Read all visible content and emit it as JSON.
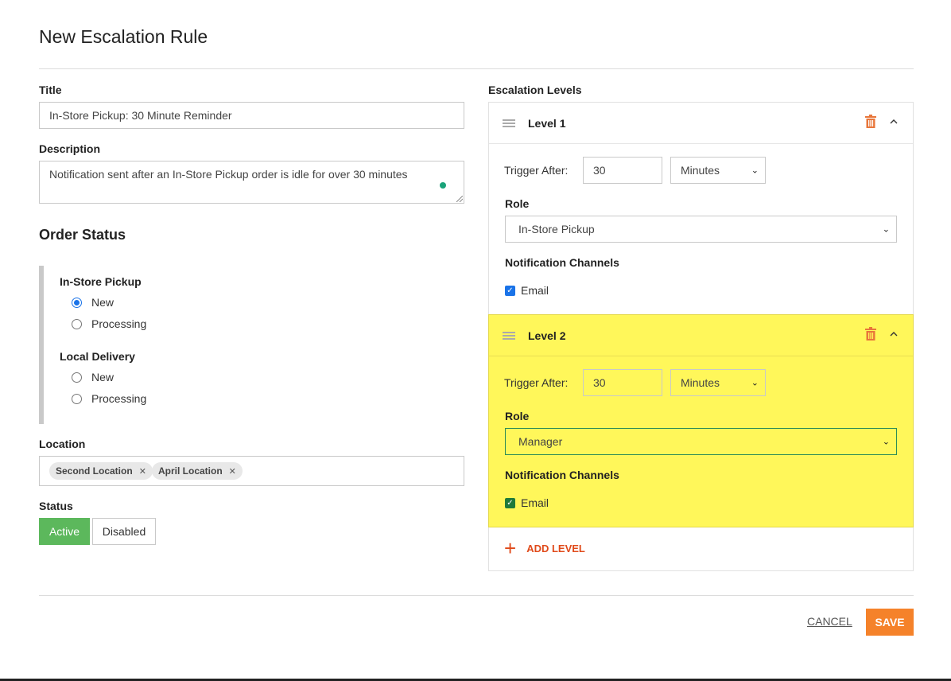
{
  "dialog": {
    "title": "New Escalation Rule"
  },
  "form": {
    "title_label": "Title",
    "title_value": "In-Store Pickup: 30 Minute Reminder",
    "description_label": "Description",
    "description_value": "Notification sent after an In-Store Pickup order is idle for over 30 minutes",
    "order_status_heading": "Order Status",
    "order_status_groups": [
      {
        "label": "In-Store Pickup",
        "options": [
          {
            "label": "New",
            "checked": true
          },
          {
            "label": "Processing",
            "checked": false
          }
        ]
      },
      {
        "label": "Local Delivery",
        "options": [
          {
            "label": "New",
            "checked": false
          },
          {
            "label": "Processing",
            "checked": false
          }
        ]
      }
    ],
    "location_label": "Location",
    "locations": [
      "Second Location",
      "April Location"
    ],
    "status_label": "Status",
    "status_options": [
      "Active",
      "Disabled"
    ],
    "status_selected": "Active"
  },
  "escalation": {
    "heading": "Escalation Levels",
    "levels": [
      {
        "title": "Level 1",
        "trigger_label": "Trigger After:",
        "trigger_value": "30",
        "trigger_unit": "Minutes",
        "role_label": "Role",
        "role_value": "In-Store Pickup",
        "channels_label": "Notification Channels",
        "channel": "Email",
        "channel_checked": true
      },
      {
        "title": "Level 2",
        "trigger_label": "Trigger After:",
        "trigger_value": "30",
        "trigger_unit": "Minutes",
        "role_label": "Role",
        "role_value": "Manager",
        "channels_label": "Notification Channels",
        "channel": "Email",
        "channel_checked": true,
        "highlight_color": "#fff75a"
      }
    ],
    "add_level_label": "ADD LEVEL"
  },
  "footer": {
    "cancel_label": "CANCEL",
    "save_label": "SAVE"
  },
  "colors": {
    "active_green": "#5cb85c",
    "accent_orange": "#f5822a",
    "trash_orange": "#e8763a",
    "link_red": "#e04a1a"
  },
  "icons": [
    "trash-icon",
    "chevron-up-icon",
    "drag-handle-icon",
    "plus-icon",
    "remove-chip-icon",
    "chevron-down-icon",
    "check-icon"
  ]
}
